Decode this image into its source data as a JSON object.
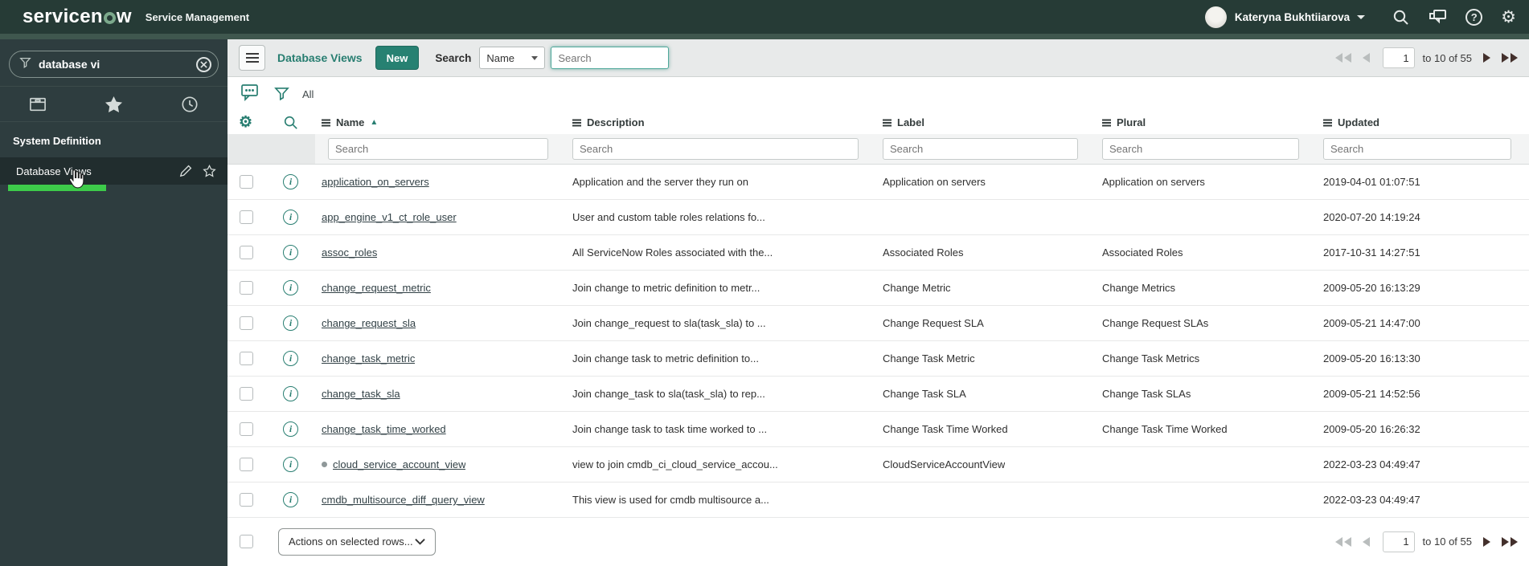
{
  "header": {
    "logo_prefix": "servicen",
    "logo_suffix": "w",
    "product": "Service Management",
    "user_name": "Kateryna Bukhtiiarova"
  },
  "sidebar": {
    "search_value": "database vi",
    "section_label": "System Definition",
    "item_label": "Database Views"
  },
  "toolbar": {
    "title": "Database Views",
    "new_button": "New",
    "search_label": "Search",
    "search_field": "Name",
    "search_placeholder": "Search"
  },
  "breadcrumb": {
    "all_label": "All"
  },
  "pagination": {
    "page_value": "1",
    "range_text": "to 10 of 55"
  },
  "table": {
    "columns": {
      "name": "Name",
      "description": "Description",
      "label": "Label",
      "plural": "Plural",
      "updated": "Updated"
    },
    "filter_placeholder": "Search",
    "rows": [
      {
        "name": "application_on_servers",
        "description": "Application and the server they run on",
        "label": "Application on servers",
        "plural": "Application on servers",
        "updated": "2019-04-01 01:07:51",
        "dot": false
      },
      {
        "name": "app_engine_v1_ct_role_user",
        "description": "User and custom table roles relations fo...",
        "label": "",
        "plural": "",
        "updated": "2020-07-20 14:19:24",
        "dot": false
      },
      {
        "name": "assoc_roles",
        "description": "All ServiceNow Roles associated with the...",
        "label": "Associated Roles",
        "plural": "Associated Roles",
        "updated": "2017-10-31 14:27:51",
        "dot": false
      },
      {
        "name": "change_request_metric",
        "description": "Join change to metric definition to metr...",
        "label": "Change Metric",
        "plural": "Change Metrics",
        "updated": "2009-05-20 16:13:29",
        "dot": false
      },
      {
        "name": "change_request_sla",
        "description": "Join change_request to sla(task_sla) to ...",
        "label": "Change Request SLA",
        "plural": "Change Request SLAs",
        "updated": "2009-05-21 14:47:00",
        "dot": false
      },
      {
        "name": "change_task_metric",
        "description": "Join change task to metric definition to...",
        "label": "Change Task Metric",
        "plural": "Change Task Metrics",
        "updated": "2009-05-20 16:13:30",
        "dot": false
      },
      {
        "name": "change_task_sla",
        "description": "Join change_task to sla(task_sla) to rep...",
        "label": "Change Task SLA",
        "plural": "Change Task SLAs",
        "updated": "2009-05-21 14:52:56",
        "dot": false
      },
      {
        "name": "change_task_time_worked",
        "description": "Join change task to task time worked to ...",
        "label": "Change Task Time Worked",
        "plural": "Change Task Time Worked",
        "updated": "2009-05-20 16:26:32",
        "dot": false
      },
      {
        "name": "cloud_service_account_view",
        "description": "view to join cmdb_ci_cloud_service_accou...",
        "label": "CloudServiceAccountView",
        "plural": "",
        "updated": "2022-03-23 04:49:47",
        "dot": true
      },
      {
        "name": "cmdb_multisource_diff_query_view",
        "description": "This view is used for cmdb multisource a...",
        "label": "",
        "plural": "",
        "updated": "2022-03-23 04:49:47",
        "dot": false
      }
    ]
  },
  "footer": {
    "actions_label": "Actions on selected rows..."
  },
  "icons": {
    "sort_asc": "▲",
    "gear": "⚙",
    "help": "?",
    "info": "i"
  },
  "colors": {
    "accent": "#287e71",
    "progress_green": "#3dcb4a",
    "header_bg": "#263b36"
  }
}
